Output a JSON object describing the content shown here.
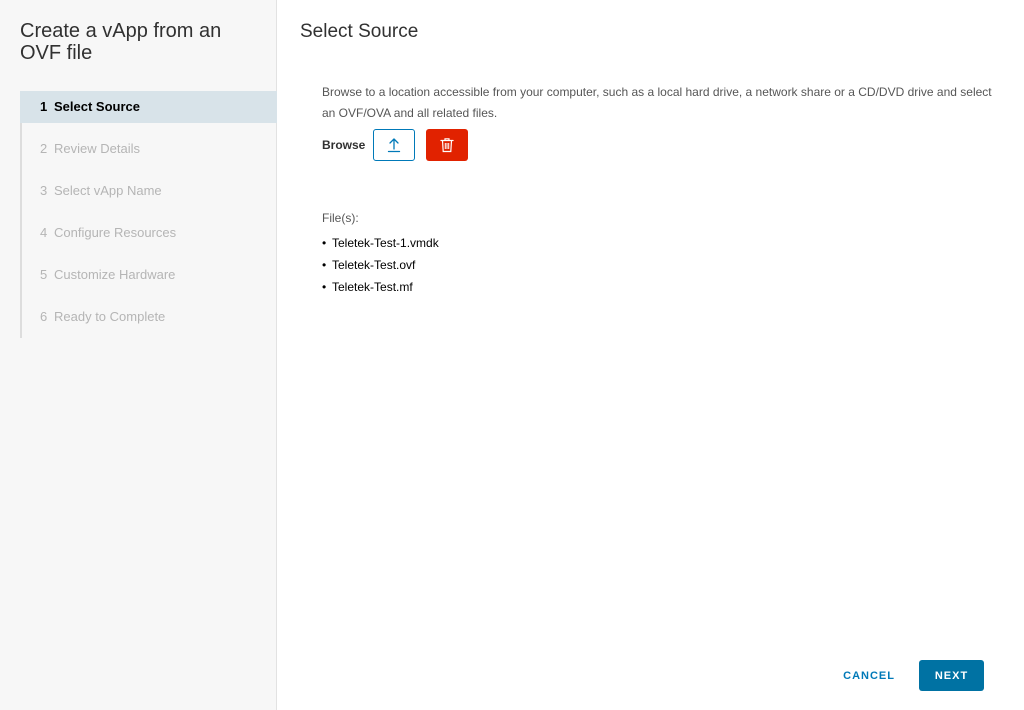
{
  "wizard": {
    "title": "Create a vApp from an OVF file",
    "steps": [
      {
        "num": "1",
        "label": "Select Source",
        "active": true
      },
      {
        "num": "2",
        "label": "Review Details",
        "active": false
      },
      {
        "num": "3",
        "label": "Select vApp Name",
        "active": false
      },
      {
        "num": "4",
        "label": "Configure Resources",
        "active": false
      },
      {
        "num": "5",
        "label": "Customize Hardware",
        "active": false
      },
      {
        "num": "6",
        "label": "Ready to Complete",
        "active": false
      }
    ]
  },
  "main": {
    "title": "Select Source",
    "description": "Browse to a location accessible from your computer, such as a local hard drive, a network share or a CD/DVD drive and select an OVF/OVA and all related files.",
    "browse_label": "Browse",
    "upload_icon": "upload-icon",
    "delete_icon": "trash-icon",
    "files_label": "File(s):",
    "files": [
      "Teletek-Test-1.vmdk",
      "Teletek-Test.ovf",
      "Teletek-Test.mf"
    ]
  },
  "footer": {
    "cancel_label": "CANCEL",
    "next_label": "NEXT"
  },
  "colors": {
    "accent": "#0079b8",
    "primary_button": "#0072a3",
    "danger": "#e12200",
    "active_step_bg": "#d8e3e9"
  }
}
